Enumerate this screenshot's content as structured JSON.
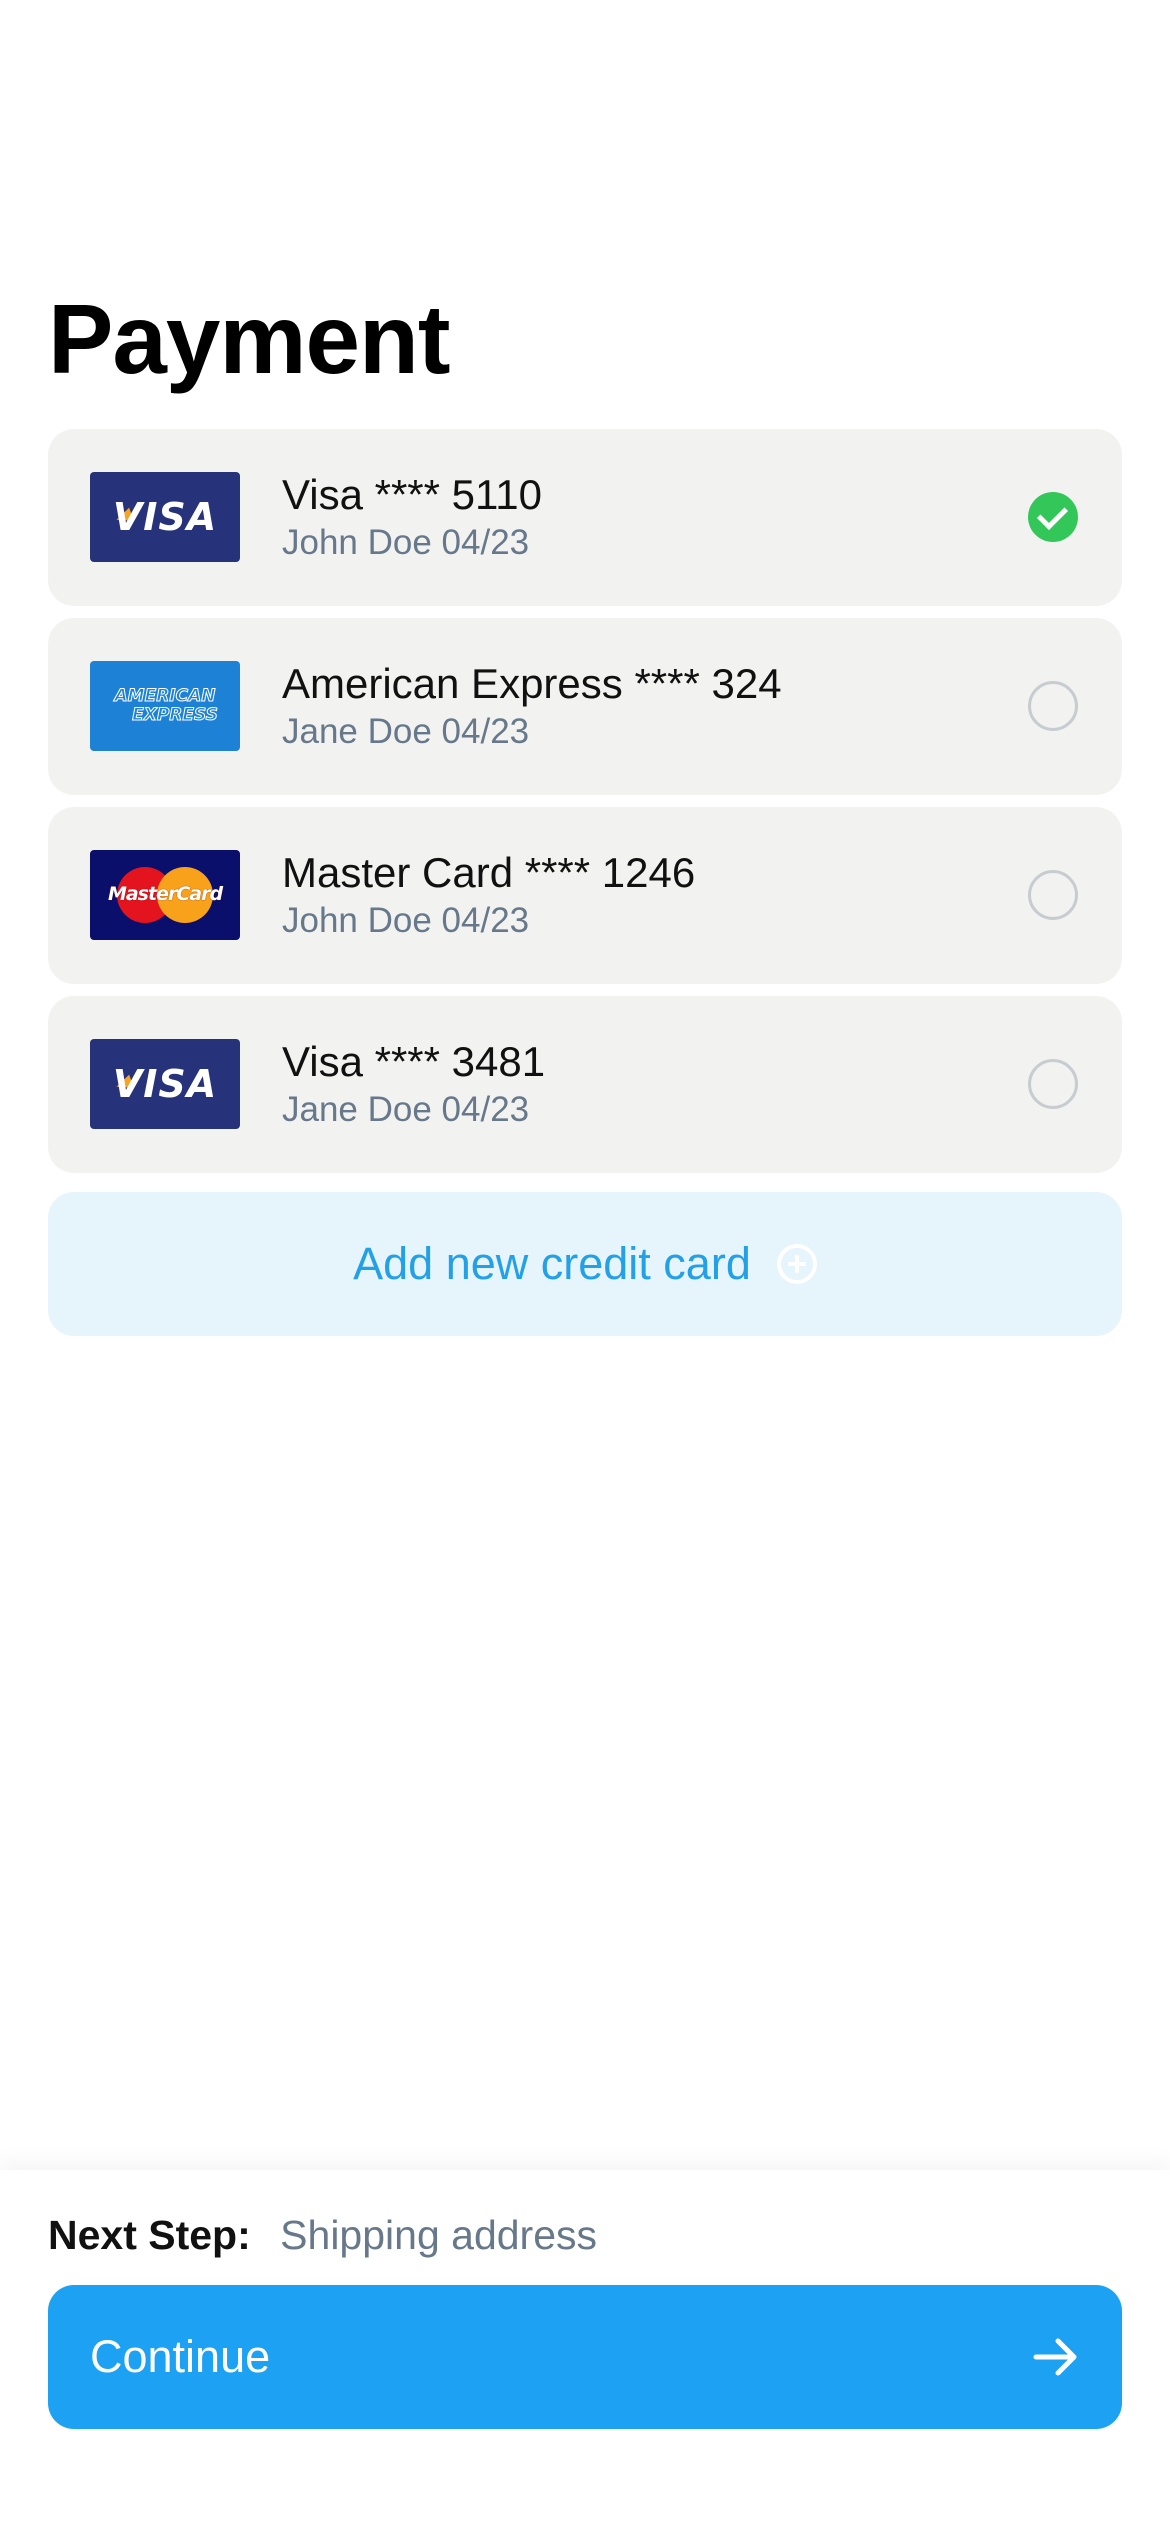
{
  "page": {
    "title": "Payment"
  },
  "cards": [
    {
      "brand": "visa-logo",
      "title": "Visa **** 5110",
      "subtitle": "John Doe 04/23",
      "selected": true
    },
    {
      "brand": "amex-logo",
      "title": "American Express **** 324",
      "subtitle": "Jane Doe 04/23",
      "selected": false
    },
    {
      "brand": "mastercard-logo",
      "title": "Master Card **** 1246",
      "subtitle": "John Doe 04/23",
      "selected": false
    },
    {
      "brand": "visa-logo",
      "title": "Visa **** 3481",
      "subtitle": "Jane Doe 04/23",
      "selected": false
    }
  ],
  "logos": {
    "visa": "VISA",
    "amex_line1": "AMERICAN",
    "amex_line2": "EXPRESS",
    "mastercard": "MasterCard"
  },
  "add_card": {
    "label": "Add new credit card",
    "icon": "plus-circle-icon"
  },
  "footer": {
    "next_step_label": "Next Step:",
    "next_step_value": "Shipping address",
    "continue_label": "Continue",
    "continue_icon": "arrow-right-icon"
  },
  "colors": {
    "accent": "#1da1f2",
    "selected_check": "#33c659",
    "card_background": "#f2f2f1",
    "add_card_background": "#e6f4fc"
  }
}
